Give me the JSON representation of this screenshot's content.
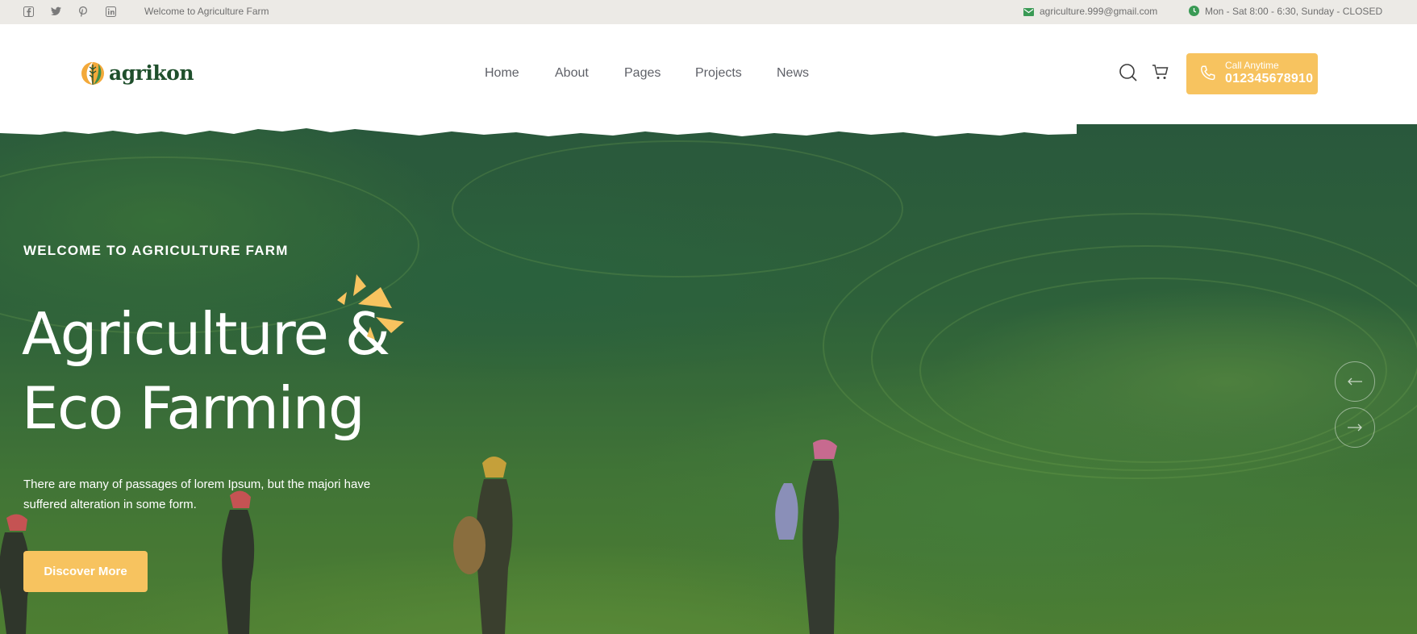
{
  "topbar": {
    "social_icons": [
      "facebook-icon",
      "twitter-icon",
      "pinterest-icon",
      "linkedin-icon"
    ],
    "welcome": "Welcome to Agriculture Farm",
    "email": "agriculture.999@gmail.com",
    "hours": "Mon - Sat 8:00 - 6:30, Sunday - CLOSED"
  },
  "header": {
    "logo_text": "agrikon",
    "nav": [
      "Home",
      "About",
      "Pages",
      "Projects",
      "News"
    ],
    "call_label": "Call Anytime",
    "call_number": "012345678910"
  },
  "hero": {
    "eyebrow": "WELCOME TO AGRICULTURE FARM",
    "title_line1": "Agriculture &",
    "title_line2": "Eco Farming",
    "paragraph": "There are many of passages of lorem Ipsum, but the majori have suffered alteration in some form.",
    "cta": "Discover More"
  },
  "colors": {
    "accent": "#f7c35f",
    "brand_green": "#1f4f2c",
    "topbar_bg": "#eceae6",
    "text_muted": "#6f6f6f"
  }
}
